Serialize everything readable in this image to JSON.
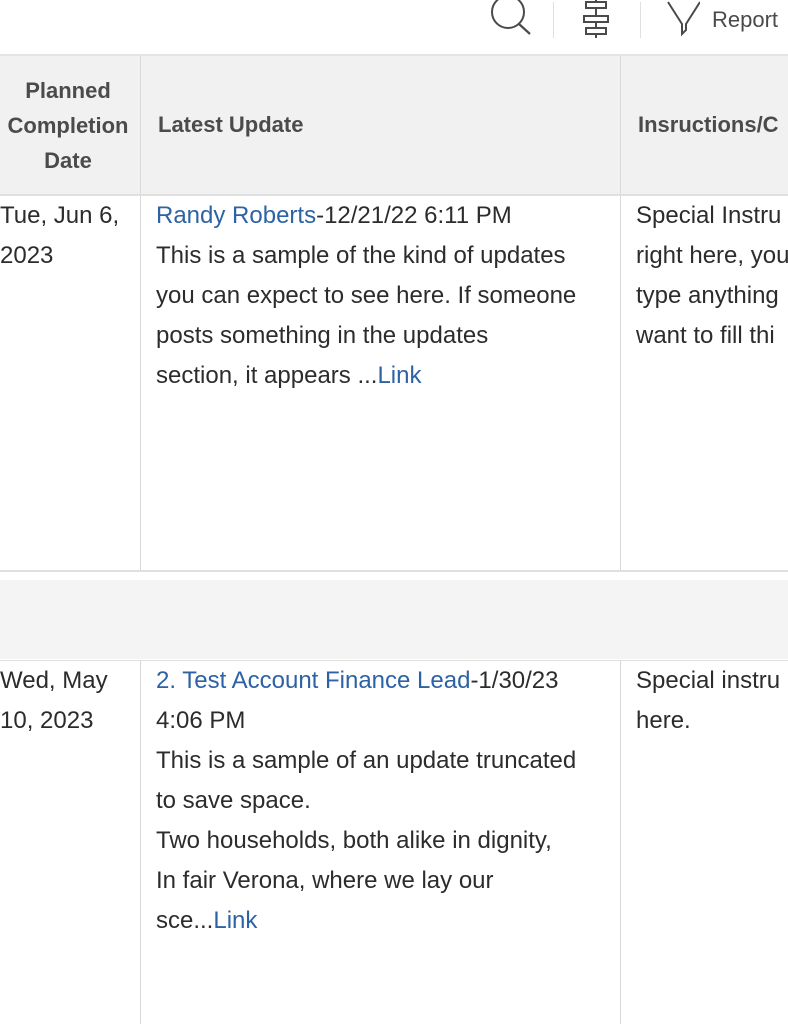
{
  "toolbar": {
    "search_icon": "search-icon",
    "sitemap_icon": "sitemap-icon",
    "filter_icon": "filter-icon",
    "report_label": "Report"
  },
  "columns": {
    "planned": [
      "Planned",
      "Completion",
      "Date"
    ],
    "latest": "Latest Update",
    "instructions": "Insructions/C"
  },
  "rows": [
    {
      "date_lines": [
        "Tue, Jun 6,",
        "2023"
      ],
      "author": "Randy Roberts",
      "timestamp": "-12/21/22 6:11 PM",
      "timestamp_wrap": "",
      "body_lines": [
        "This is a sample of the kind of updates",
        "you can expect to see here. If someone",
        "posts something in the updates",
        "section, it appears ..."
      ],
      "link": "Link",
      "instr_lines": [
        "Special Instru",
        "right here, you",
        "type anything",
        "want to fill thi"
      ]
    },
    {
      "date_lines": [
        "Wed, May",
        "10, 2023"
      ],
      "author": "2. Test Account Finance Lead",
      "timestamp": "-1/30/23",
      "timestamp_wrap": "4:06 PM",
      "body_lines": [
        "This is a sample of an update truncated",
        "to save space.",
        "Two households, both alike in dignity,",
        "In fair Verona, where we lay our",
        "sce..."
      ],
      "link": "Link",
      "instr_lines": [
        "Special instru",
        "here."
      ]
    }
  ],
  "colors": {
    "link": "#2d62a5",
    "header_bg": "#f1f1f1",
    "border": "#e0e0e0"
  }
}
